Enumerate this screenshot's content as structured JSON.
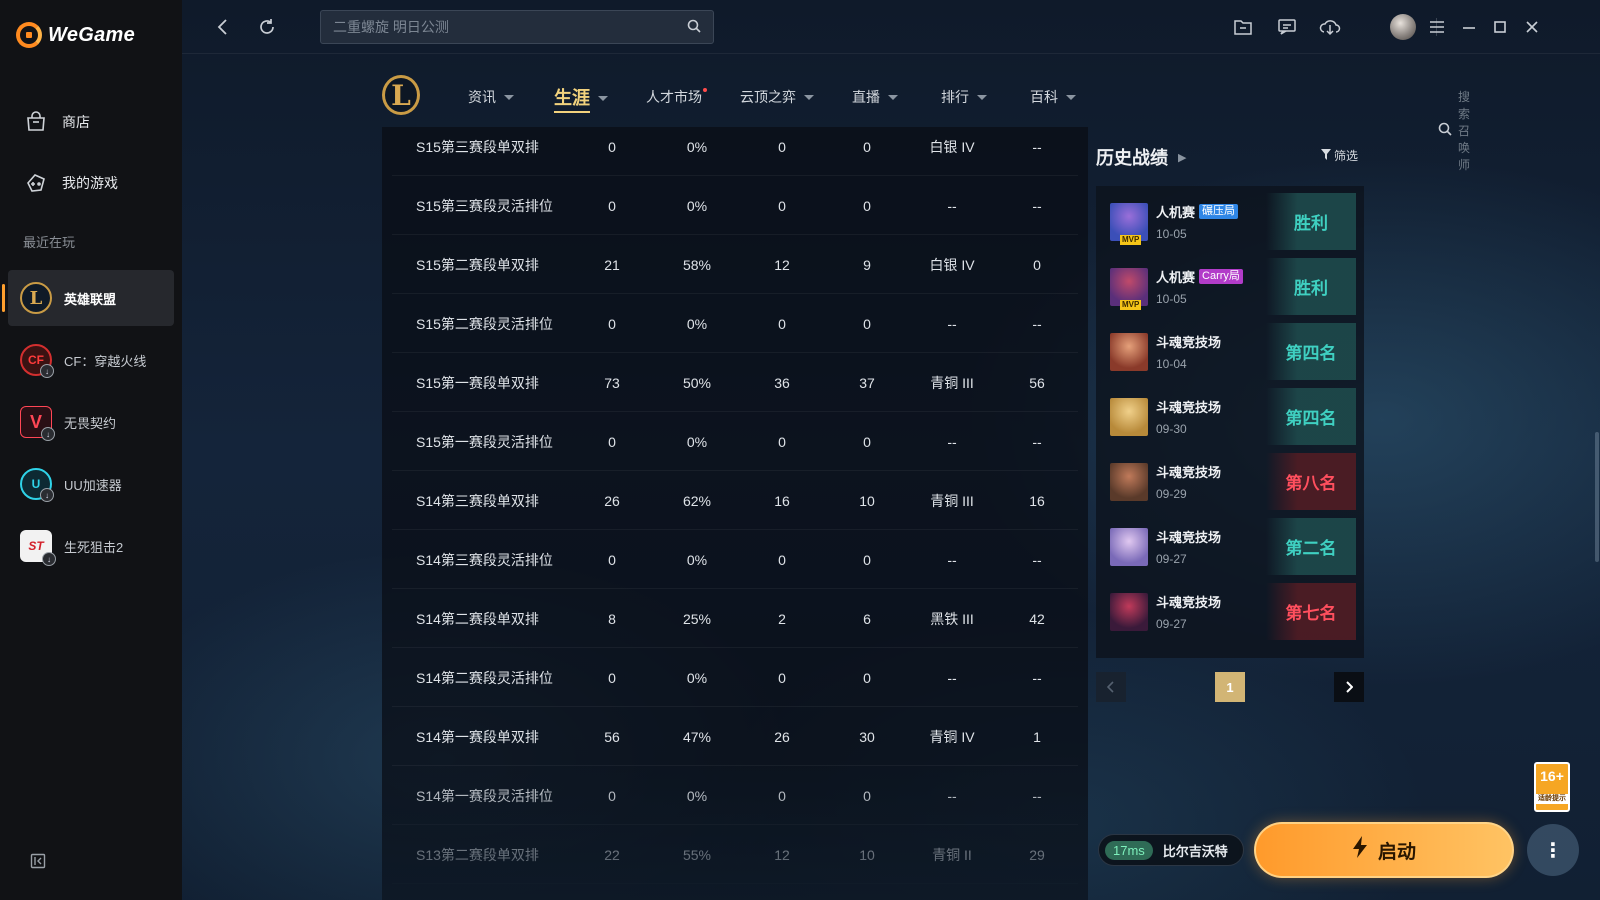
{
  "app": {
    "brand": "WeGame"
  },
  "sidebar": {
    "nav": [
      {
        "label": "商店",
        "icon": "store-icon"
      },
      {
        "label": "我的游戏",
        "icon": "gamepad-icon"
      }
    ],
    "section_label": "最近在玩",
    "games": [
      {
        "label": "英雄联盟",
        "icon": "lol-icon",
        "active": true
      },
      {
        "label": "CF：穿越火线",
        "icon": "cf-icon"
      },
      {
        "label": "无畏契约",
        "icon": "valorant-icon"
      },
      {
        "label": "UU加速器",
        "icon": "uu-icon"
      },
      {
        "label": "生死狙击2",
        "icon": "ssjj-icon"
      }
    ]
  },
  "topbar": {
    "search_placeholder": "二重螺旋 明日公测"
  },
  "subnav": {
    "logo_text": "L",
    "tabs": [
      {
        "label": "资讯"
      },
      {
        "label": "生涯",
        "active": true
      },
      {
        "label": "人才市场"
      },
      {
        "label": "云顶之弈"
      },
      {
        "label": "直播"
      },
      {
        "label": "排行"
      },
      {
        "label": "百科"
      }
    ],
    "summoner_search": "搜索召唤师"
  },
  "season_table": {
    "rows": [
      [
        "S15第三赛段单双排",
        "0",
        "0%",
        "0",
        "0",
        "白银 IV",
        "--"
      ],
      [
        "S15第三赛段灵活排位",
        "0",
        "0%",
        "0",
        "0",
        "--",
        "--"
      ],
      [
        "S15第二赛段单双排",
        "21",
        "58%",
        "12",
        "9",
        "白银 IV",
        "0"
      ],
      [
        "S15第二赛段灵活排位",
        "0",
        "0%",
        "0",
        "0",
        "--",
        "--"
      ],
      [
        "S15第一赛段单双排",
        "73",
        "50%",
        "36",
        "37",
        "青铜 III",
        "56"
      ],
      [
        "S15第一赛段灵活排位",
        "0",
        "0%",
        "0",
        "0",
        "--",
        "--"
      ],
      [
        "S14第三赛段单双排",
        "26",
        "62%",
        "16",
        "10",
        "青铜 III",
        "16"
      ],
      [
        "S14第三赛段灵活排位",
        "0",
        "0%",
        "0",
        "0",
        "--",
        "--"
      ],
      [
        "S14第二赛段单双排",
        "8",
        "25%",
        "2",
        "6",
        "黑铁 III",
        "42"
      ],
      [
        "S14第二赛段灵活排位",
        "0",
        "0%",
        "0",
        "0",
        "--",
        "--"
      ],
      [
        "S14第一赛段单双排",
        "56",
        "47%",
        "26",
        "30",
        "青铜 IV",
        "1"
      ],
      [
        "S14第一赛段灵活排位",
        "0",
        "0%",
        "0",
        "0",
        "--",
        "--"
      ],
      [
        "S13第二赛段单双排",
        "22",
        "55%",
        "12",
        "10",
        "青铜 II",
        "29"
      ]
    ]
  },
  "history": {
    "title": "历史战绩",
    "filter_label": "筛选",
    "matches": [
      {
        "mode": "人机赛",
        "tag": "碾压局",
        "tag_color": "#2f86e6",
        "mvp": "MVP",
        "date": "10-05",
        "result": "胜利",
        "win": true
      },
      {
        "mode": "人机赛",
        "tag": "Carry局",
        "tag_color": "#b23cc9",
        "mvp": "MVP",
        "date": "10-05",
        "result": "胜利",
        "win": true
      },
      {
        "mode": "斗魂竞技场",
        "date": "10-04",
        "result": "第四名",
        "win": true
      },
      {
        "mode": "斗魂竞技场",
        "date": "09-30",
        "result": "第四名",
        "win": true
      },
      {
        "mode": "斗魂竞技场",
        "date": "09-29",
        "result": "第八名",
        "win": false
      },
      {
        "mode": "斗魂竞技场",
        "date": "09-27",
        "result": "第二名",
        "win": true
      },
      {
        "mode": "斗魂竞技场",
        "date": "09-27",
        "result": "第七名",
        "win": false
      }
    ],
    "page": "1"
  },
  "footer": {
    "age_rating": "16+",
    "age_note": "适龄提示",
    "ping": "17ms",
    "server": "比尔吉沃特",
    "launch_label": "启动"
  }
}
